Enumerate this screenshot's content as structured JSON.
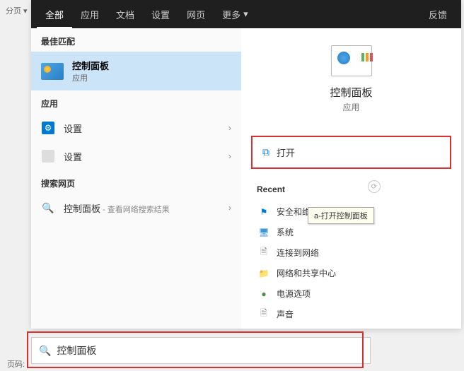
{
  "outer": {
    "tab": "分页 ▾",
    "footer": "页码:"
  },
  "topbar": {
    "tabs": [
      "全部",
      "应用",
      "文档",
      "设置",
      "网页"
    ],
    "more": "更多",
    "feedback": "反馈"
  },
  "left": {
    "best_match_label": "最佳匹配",
    "best_match": {
      "title": "控制面板",
      "subtitle": "应用"
    },
    "apps_label": "应用",
    "apps": [
      {
        "label": "设置"
      },
      {
        "label": "设置"
      }
    ],
    "web_label": "搜索网页",
    "web": {
      "query": "控制面板",
      "suffix": " - 查看网络搜索结果"
    }
  },
  "right": {
    "title": "控制面板",
    "subtitle": "应用",
    "open": "打开",
    "recent_label": "Recent",
    "recent": [
      {
        "label": "安全和维护",
        "icon": "flag",
        "color": "#0078d4"
      },
      {
        "label": "系统",
        "icon": "monitor",
        "color": "#3a96dd"
      },
      {
        "label": "连接到网络",
        "icon": "doc",
        "color": "#888"
      },
      {
        "label": "网络和共享中心",
        "icon": "folder",
        "color": "#f0a020"
      },
      {
        "label": "电源选项",
        "icon": "power",
        "color": "#4a9048"
      },
      {
        "label": "声音",
        "icon": "doc",
        "color": "#888"
      }
    ],
    "tooltip": "a-打开控制面板"
  },
  "search": {
    "value": "控制面板"
  }
}
